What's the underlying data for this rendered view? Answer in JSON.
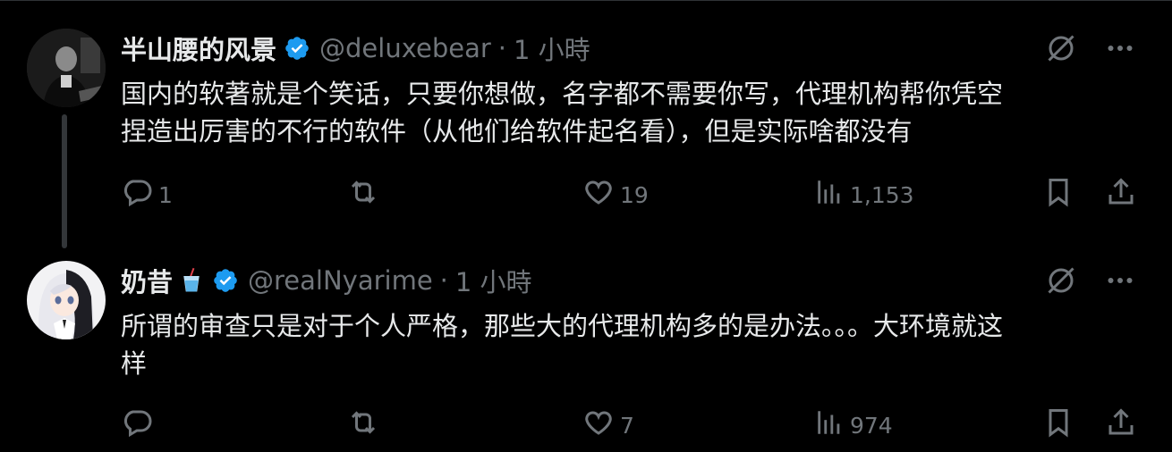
{
  "colors": {
    "background": "#000000",
    "text": "#e7e9ea",
    "muted": "#71767b",
    "verified": "#1d9bf0",
    "thread_line": "#333639"
  },
  "tweets": [
    {
      "display_name": "半山腰的风景",
      "handle": "@deluxebear",
      "dot": "·",
      "time": "1 小時",
      "text_lines": [
        "国内的软著就是个笑话，只要你想做，名字都不需要你写，代理机构帮你凭空",
        "捏造出厉害的不行的软件（从他们给软件起名看），但是实际啥都没有"
      ],
      "replies": "1",
      "retweets": "",
      "likes": "19",
      "views": "1,153",
      "icons": [
        "grok-icon",
        "more-icon",
        "reply-icon",
        "retweet-icon",
        "like-icon",
        "views-icon",
        "bookmark-icon",
        "share-icon"
      ]
    },
    {
      "display_name": "奶昔",
      "emoji": "🥤",
      "handle": "@realNyarime",
      "dot": "·",
      "time": "1 小時",
      "text_lines": [
        "所谓的审查只是对于个人严格，那些大的代理机构多的是办法。。。大环境就这",
        "样"
      ],
      "replies": "",
      "retweets": "",
      "likes": "7",
      "views": "974",
      "icons": [
        "grok-icon",
        "more-icon",
        "reply-icon",
        "retweet-icon",
        "like-icon",
        "views-icon",
        "bookmark-icon",
        "share-icon"
      ]
    }
  ]
}
